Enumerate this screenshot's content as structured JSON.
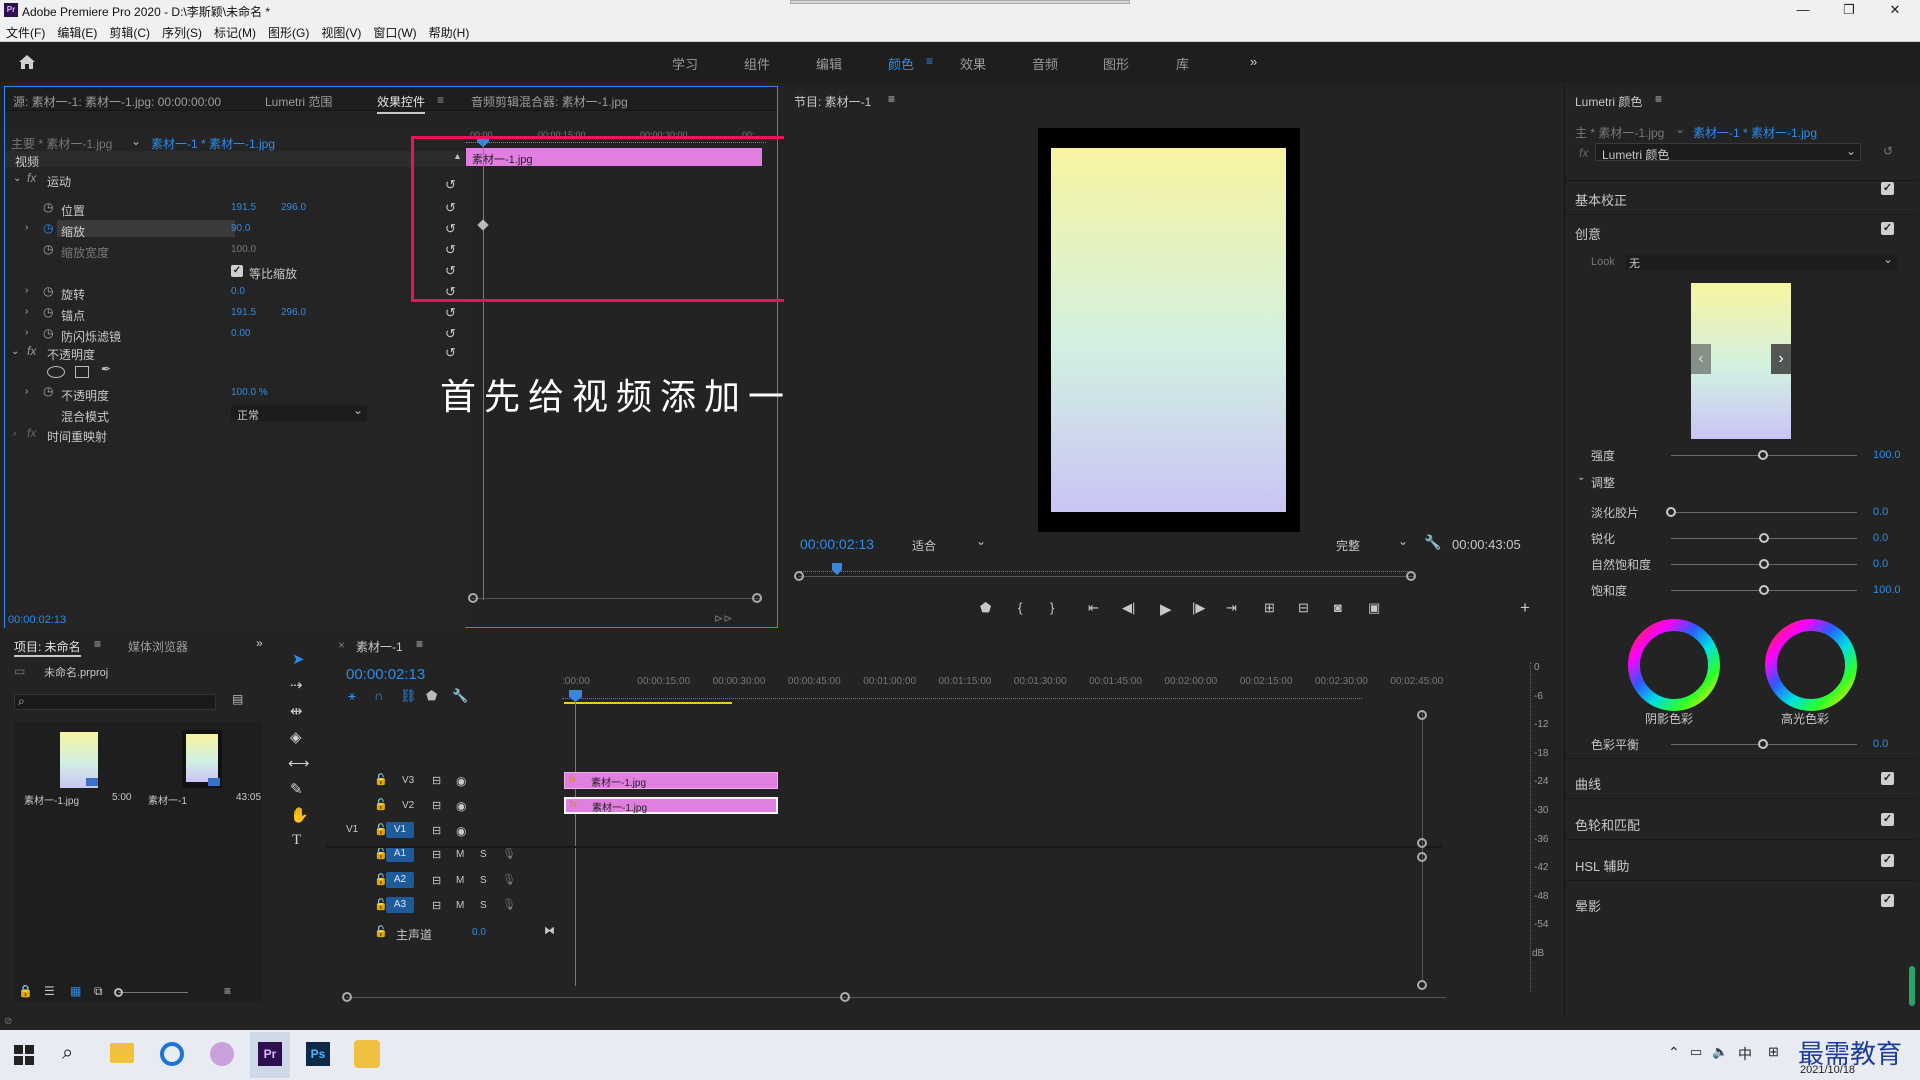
{
  "window": {
    "title": "Adobe Premiere Pro 2020 - D:\\李斯颖\\未命名 *",
    "minimize": "—",
    "restore": "❐",
    "close": "✕",
    "icon_text": "Pr"
  },
  "menu": [
    "文件(F)",
    "编辑(E)",
    "剪辑(C)",
    "序列(S)",
    "标记(M)",
    "图形(G)",
    "视图(V)",
    "窗口(W)",
    "帮助(H)"
  ],
  "workspaces": {
    "items": [
      "学习",
      "组件",
      "编辑",
      "颜色",
      "效果",
      "音频",
      "图形",
      "库"
    ],
    "active": "颜色",
    "more": "»"
  },
  "effect_controls": {
    "tabs": [
      "源: 素材一-1: 素材一-1.jpg: 00:00:00:00",
      "Lumetri 范围",
      "效果控件",
      "音频剪辑混合器: 素材一-1.jpg"
    ],
    "active_tab": "效果控件",
    "master": "主要 * 素材一-1.jpg",
    "sequence": "素材一-1 * 素材一-1.jpg",
    "mini_ticks": [
      "00:00",
      "00:00:15:00",
      "00:00:30:00",
      "00:"
    ],
    "clip_label": "素材一-1.jpg",
    "video_label": "视频",
    "motion": "运动",
    "props": [
      {
        "name": "位置",
        "v1": "191.5",
        "v2": "296.0"
      },
      {
        "name": "缩放",
        "v1": "90.0",
        "v2": ""
      },
      {
        "name": "缩放宽度",
        "v1": "100.0",
        "v2": ""
      },
      {
        "name": "等比缩放",
        "v1": "",
        "v2": ""
      },
      {
        "name": "旋转",
        "v1": "0.0",
        "v2": ""
      },
      {
        "name": "锚点",
        "v1": "191.5",
        "v2": "296.0"
      },
      {
        "name": "防闪烁滤镜",
        "v1": "0.00",
        "v2": ""
      }
    ],
    "opacity_group": "不透明度",
    "opacity": {
      "name": "不透明度",
      "value": "100.0 %"
    },
    "blend": {
      "name": "混合模式",
      "value": "正常"
    },
    "time_remap": "时间重映射",
    "timecode": "00:00:02:13"
  },
  "annotation": "首先给视频添加一个效果",
  "program": {
    "title": "节目: 素材一-1",
    "timecode": "00:00:02:13",
    "fit": "适合",
    "quality": "完整",
    "duration": "00:00:43:05",
    "gradient_colors": [
      "#f7f4a0",
      "#d2f0e2",
      "#c9c4f5"
    ]
  },
  "lumetri": {
    "title": "Lumetri 颜色",
    "master": "主 * 素材一-1.jpg",
    "sequence": "素材一-1 * 素材一-1.jpg",
    "effect": "Lumetri 颜色",
    "sections": {
      "basic": "基本校正",
      "creative": "创意",
      "curves": "曲线",
      "wheels": "色轮和匹配",
      "hsl": "HSL 辅助",
      "vignette": "晕影"
    },
    "look_label": "Look",
    "look_value": "无",
    "intensity": {
      "label": "强度",
      "value": "100.0",
      "fraction": 0.5
    },
    "adjust": "调整",
    "adjusts": [
      {
        "label": "淡化胶片",
        "value": "0.0",
        "fraction": 0.0
      },
      {
        "label": "锐化",
        "value": "0.0",
        "fraction": 0.5
      },
      {
        "label": "自然饱和度",
        "value": "0.0",
        "fraction": 0.5
      },
      {
        "label": "饱和度",
        "value": "100.0",
        "fraction": 0.5
      }
    ],
    "wheel_shadow": "阴影色彩",
    "wheel_highlight": "高光色彩",
    "balance": {
      "label": "色彩平衡",
      "value": "0.0",
      "fraction": 0.5
    }
  },
  "project": {
    "tabs": [
      "项目: 未命名",
      "媒体浏览器"
    ],
    "file": "未命名.prproj",
    "items": [
      {
        "name": "素材一-1.jpg",
        "duration": "5:00"
      },
      {
        "name": "素材一-1",
        "duration": "43:05"
      }
    ]
  },
  "timeline": {
    "title": "素材一-1",
    "timecode": "00:00:02:13",
    "ticks": [
      ":00:00",
      "00:00:15:00",
      "00:00:30:00",
      "00:00:45:00",
      "00:01:00:00",
      "00:01:15:00",
      "00:01:30:00",
      "00:01:45:00",
      "00:02:00:00",
      "00:02:15:00",
      "00:02:30:00",
      "00:02:45:00"
    ],
    "video_tracks": [
      "V3",
      "V2",
      "V1"
    ],
    "audio_tracks": [
      "A1",
      "A2",
      "A3"
    ],
    "source_v": "V1",
    "master": "主声道",
    "master_value": "0.0",
    "clip_name": "素材一-1.jpg",
    "mute": "M",
    "solo": "S",
    "db": [
      "0",
      "-6",
      "-12",
      "-18",
      "-24",
      "-30",
      "-36",
      "-42",
      "-48",
      "-54",
      "dB"
    ]
  },
  "taskbar": {
    "date": "2021/10/18",
    "ime": "中",
    "watermark": "最需教育",
    "pr": "Pr",
    "ps": "Ps"
  }
}
